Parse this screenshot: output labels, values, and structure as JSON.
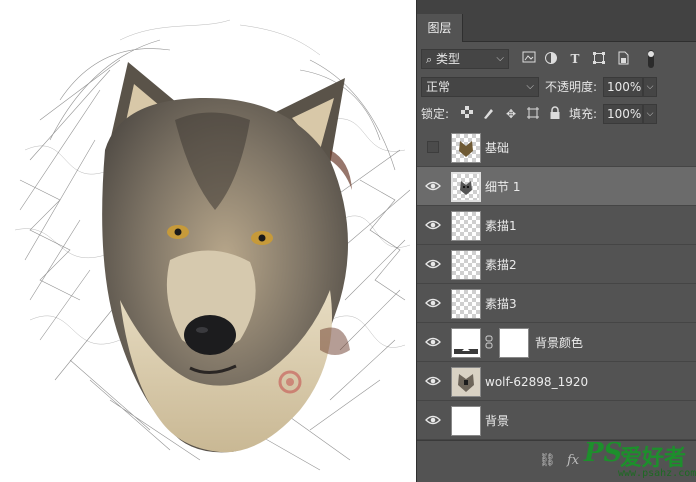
{
  "panel": {
    "tab_title": "图层",
    "filter": {
      "kind_label": "类型"
    },
    "blend": {
      "mode": "正常",
      "opacity_label": "不透明度:",
      "opacity_value": "100%"
    },
    "lock": {
      "label": "锁定:",
      "fill_label": "填充:",
      "fill_value": "100%"
    },
    "layers": [
      {
        "name": "基础",
        "visible": false,
        "selected": false
      },
      {
        "name": "细节 1",
        "visible": true,
        "selected": true
      },
      {
        "name": "素描1",
        "visible": true,
        "selected": false
      },
      {
        "name": "素描2",
        "visible": true,
        "selected": false
      },
      {
        "name": "素描3",
        "visible": true,
        "selected": false
      },
      {
        "name": "背景颜色",
        "visible": true,
        "selected": false
      },
      {
        "name": "wolf-62898_1920",
        "visible": true,
        "selected": false
      },
      {
        "name": "背景",
        "visible": true,
        "selected": false
      }
    ],
    "footer_icons": [
      "link-icon",
      "fx-icon"
    ]
  },
  "watermark": {
    "logo_ps": "PS",
    "logo_cn": "爱好者",
    "url": "www.psahz.com"
  },
  "colors": {
    "panel_bg": "#535353",
    "panel_dark": "#424242",
    "selected_row": "#6b6b6b",
    "watermark_green": "#1d8f2c"
  }
}
